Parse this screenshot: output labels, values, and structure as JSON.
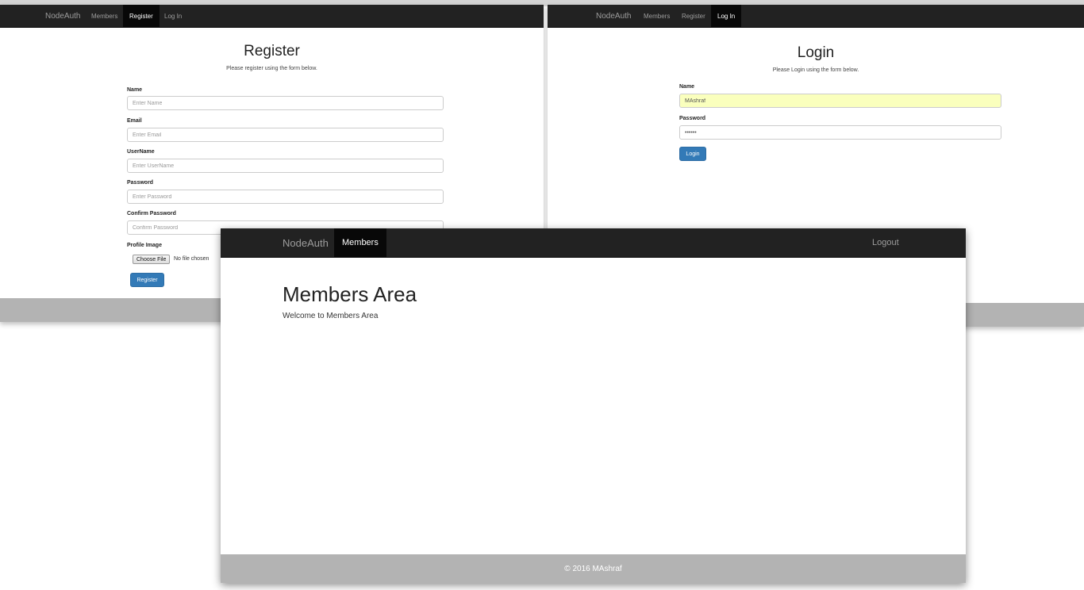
{
  "register_window": {
    "nav": {
      "brand": "NodeAuth",
      "items": [
        {
          "label": "Members",
          "active": false
        },
        {
          "label": "Register",
          "active": true
        },
        {
          "label": "Log In",
          "active": false
        }
      ]
    },
    "title": "Register",
    "subtitle": "Please register using the form below.",
    "fields": [
      {
        "label": "Name",
        "placeholder": "Enter Name"
      },
      {
        "label": "Email",
        "placeholder": "Enter Email"
      },
      {
        "label": "UserName",
        "placeholder": "Enter UserName"
      },
      {
        "label": "Password",
        "placeholder": "Enter Password"
      },
      {
        "label": "Confirm Password",
        "placeholder": "Confirm Password"
      }
    ],
    "profile_image_label": "Profile Image",
    "choose_file_label": "Choose File",
    "no_file_text": "No file chosen",
    "submit_label": "Register"
  },
  "login_window": {
    "nav": {
      "brand": "NodeAuth",
      "items": [
        {
          "label": "Members",
          "active": false
        },
        {
          "label": "Register",
          "active": false
        },
        {
          "label": "Log In",
          "active": true
        }
      ]
    },
    "title": "Login",
    "subtitle": "Please Login using the form below.",
    "name_label": "Name",
    "name_value": "MAshraf",
    "password_label": "Password",
    "password_value": "••••••",
    "submit_label": "Login"
  },
  "members_window": {
    "nav": {
      "brand": "NodeAuth",
      "members_label": "Members",
      "logout_label": "Logout"
    },
    "heading": "Members Area",
    "welcome": "Welcome to Members Area",
    "footer": "© 2016 MAshraf"
  },
  "colors": {
    "navbar": "#222222",
    "navbar_active": "#080808",
    "primary": "#337ab7",
    "footer": "#b3b3b3",
    "autofill": "#faffbd"
  }
}
